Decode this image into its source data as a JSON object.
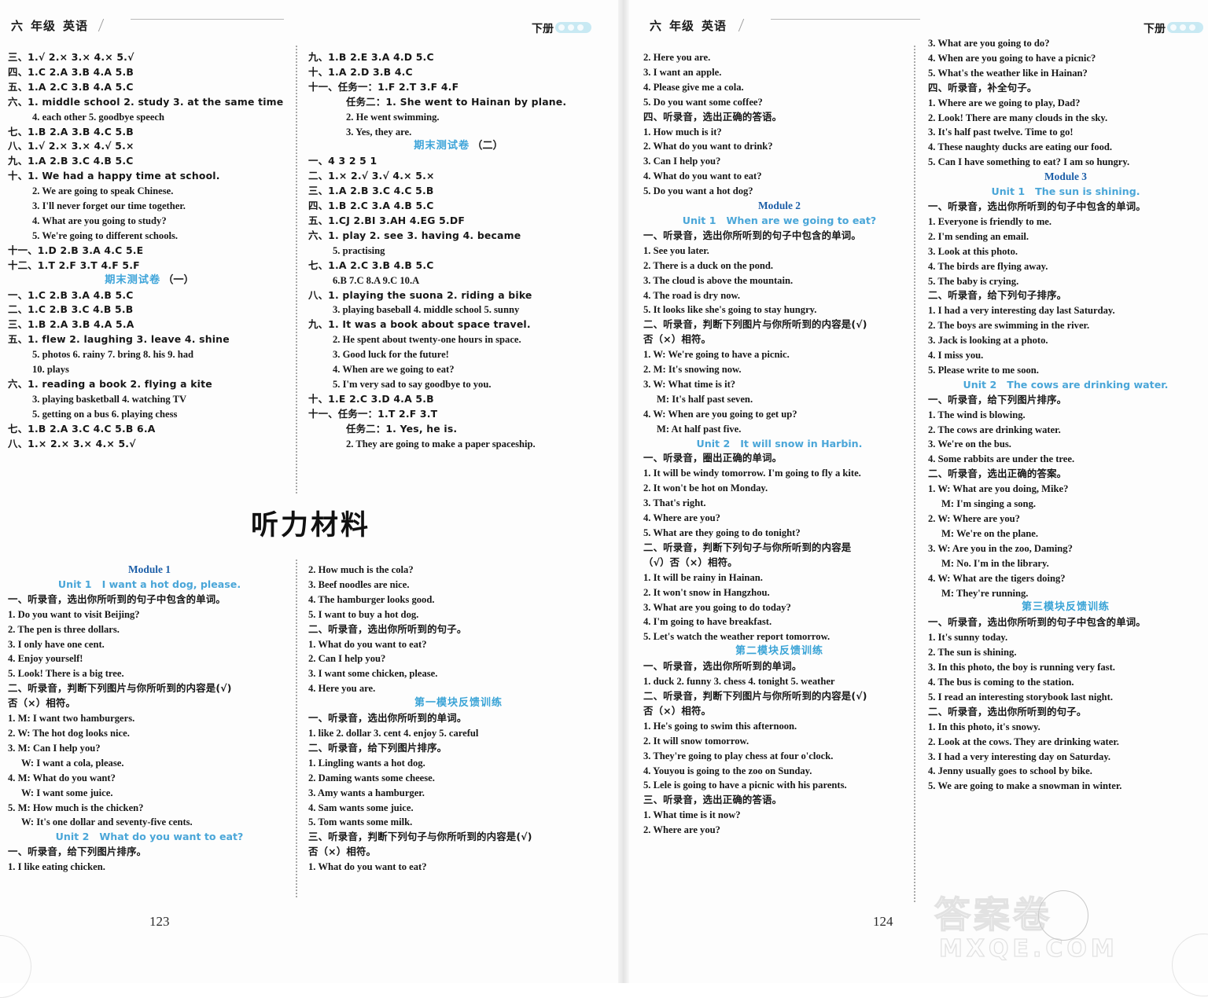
{
  "book": {
    "header_grade": "六",
    "header_grade_label": "年级",
    "header_subject": "英语",
    "header_right": "下册",
    "page_left": "123",
    "page_right": "124",
    "watermark_cn": "答案卷",
    "watermark_en": "MXQE.COM"
  },
  "section_title": "听力材料",
  "col1": {
    "lines": [
      {
        "t": "三、1.√  2.×  3.×  4.×  5.√",
        "s": "cn"
      },
      {
        "t": "四、1.C  2.A  3.B  4.A  5.B",
        "s": "cn"
      },
      {
        "t": "五、1.A  2.C  3.B  4.A  5.C",
        "s": "cn"
      },
      {
        "t": "六、1. middle school  2. study  3. at the same time",
        "s": "cn"
      },
      {
        "t": "4. each other  5. goodbye speech",
        "s": "ind2"
      },
      {
        "t": "七、1.B  2.A  3.B  4.C  5.B",
        "s": "cn"
      },
      {
        "t": "八、1.√  2.×  3.×  4.√  5.×",
        "s": "cn"
      },
      {
        "t": "九、1.A  2.B  3.C  4.B  5.C",
        "s": "cn"
      },
      {
        "t": "十、1. We had a happy time at school.",
        "s": "cn"
      },
      {
        "t": "2. We are going to speak Chinese.",
        "s": "ind2"
      },
      {
        "t": "3. I'll never forget our time together.",
        "s": "ind2"
      },
      {
        "t": "4. What are you going to study?",
        "s": "ind2"
      },
      {
        "t": "5. We're going to different schools.",
        "s": "ind2"
      },
      {
        "t": "十一、1.D  2.B  3.A  4.C  5.E",
        "s": "cn"
      },
      {
        "t": "十二、1.T  2.F  3.T  4.F  5.F",
        "s": "cn"
      },
      {
        "t": "期末测试卷（一）",
        "s": "examhd"
      },
      {
        "t": "一、1.C  2.B  3.A  4.B  5.C",
        "s": "cn"
      },
      {
        "t": "二、1.C  2.B  3.C  4.B  5.B",
        "s": "cn"
      },
      {
        "t": "三、1.B  2.A  3.B  4.A  5.A",
        "s": "cn"
      },
      {
        "t": "五、1. flew  2. laughing  3. leave  4. shine",
        "s": "cn"
      },
      {
        "t": "5. photos  6. rainy  7. bring  8. his  9. had",
        "s": "ind2"
      },
      {
        "t": "10. plays",
        "s": "ind2"
      },
      {
        "t": "六、1. reading a book  2. flying a kite",
        "s": "cn"
      },
      {
        "t": "3. playing basketball  4. watching TV",
        "s": "ind2"
      },
      {
        "t": "5. getting on a bus  6. playing chess",
        "s": "ind2"
      },
      {
        "t": "七、1.B  2.A  3.C  4.C  5.B  6.A",
        "s": "cn"
      },
      {
        "t": "八、1.×  2.×  3.×  4.×  5.√",
        "s": "cn"
      }
    ]
  },
  "col2": {
    "lines": [
      {
        "t": "九、1.B  2.E  3.A  4.D  5.C",
        "s": "cn"
      },
      {
        "t": "十、1.A  2.D  3.B  4.C",
        "s": "cn"
      },
      {
        "t": "十一、任务一：1.F  2.T  3.F  4.F",
        "s": "cn"
      },
      {
        "t": "任务二：1. She went to Hainan by plane.",
        "s": "cn ind3"
      },
      {
        "t": "2. He went swimming.",
        "s": "ind3"
      },
      {
        "t": "3. Yes, they are.",
        "s": "ind3"
      },
      {
        "t": "期末测试卷（二）",
        "s": "examhd"
      },
      {
        "t": "一、4  3  2  5  1",
        "s": "cn"
      },
      {
        "t": "二、1.×  2.√  3.√  4.×  5.×",
        "s": "cn"
      },
      {
        "t": "三、1.A  2.B  3.C  4.C  5.B",
        "s": "cn"
      },
      {
        "t": "四、1.B  2.C  3.A  4.B  5.C",
        "s": "cn"
      },
      {
        "t": "五、1.CJ  2.BI  3.AH  4.EG  5.DF",
        "s": "cn"
      },
      {
        "t": "六、1. play  2. see  3. having  4. became",
        "s": "cn"
      },
      {
        "t": "5. practising",
        "s": "ind2"
      },
      {
        "t": "七、1.A  2.C  3.B  4.B  5.C",
        "s": "cn"
      },
      {
        "t": "6.B  7.C  8.A  9.C  10.A",
        "s": "ind2"
      },
      {
        "t": "八、1. playing the suona  2. riding a bike",
        "s": "cn"
      },
      {
        "t": "3. playing baseball  4. middle school  5. sunny",
        "s": "ind2"
      },
      {
        "t": "九、1. It was a book about space travel.",
        "s": "cn"
      },
      {
        "t": "2. He spent about twenty-one hours in space.",
        "s": "ind2"
      },
      {
        "t": "3. Good luck for the future!",
        "s": "ind2"
      },
      {
        "t": "4. When are we going to eat?",
        "s": "ind2"
      },
      {
        "t": "5. I'm very sad to say goodbye to you.",
        "s": "ind2"
      },
      {
        "t": "十、1.E  2.C  3.D  4.A  5.B",
        "s": "cn"
      },
      {
        "t": "十一、任务一：1.T  2.F  3.T",
        "s": "cn"
      },
      {
        "t": "任务二：1. Yes, he is.",
        "s": "cn ind3"
      },
      {
        "t": "2. They are going to make a paper spaceship.",
        "s": "ind3"
      }
    ]
  },
  "col1b": {
    "lines": [
      {
        "t": "Module 1",
        "s": "modhd"
      },
      {
        "t": "Unit 1|I want a hot dog, please.",
        "s": "unithd"
      },
      {
        "t": "一、听录音，选出你所听到的句子中包含的单词。",
        "s": "cn"
      },
      {
        "t": "1. Do you want to visit Beijing?",
        "s": ""
      },
      {
        "t": "2. The pen is three dollars.",
        "s": ""
      },
      {
        "t": "3. I only have one cent.",
        "s": ""
      },
      {
        "t": "4. Enjoy yourself!",
        "s": ""
      },
      {
        "t": "5. Look! There is a big tree.",
        "s": ""
      },
      {
        "t": "二、听录音，判断下列图片与你所听到的内容是(√)",
        "s": "cn"
      },
      {
        "t": "否（×）相符。",
        "s": "cn"
      },
      {
        "t": "1. M: I want two hamburgers.",
        "s": ""
      },
      {
        "t": "2. W: The hot dog looks nice.",
        "s": ""
      },
      {
        "t": "3. M: Can I help you?",
        "s": ""
      },
      {
        "t": "W: I want a cola, please.",
        "s": "ind1"
      },
      {
        "t": "4. M: What do you want?",
        "s": ""
      },
      {
        "t": "W: I want some juice.",
        "s": "ind1"
      },
      {
        "t": "5. M: How much is the chicken?",
        "s": ""
      },
      {
        "t": "W: It's one dollar and seventy-five cents.",
        "s": "ind1"
      },
      {
        "t": "Unit 2|What do you want to eat?",
        "s": "unithd"
      },
      {
        "t": "一、听录音，给下列图片排序。",
        "s": "cn"
      },
      {
        "t": "1. I like eating chicken.",
        "s": ""
      }
    ]
  },
  "col2b": {
    "lines": [
      {
        "t": "2. How much is the cola?",
        "s": ""
      },
      {
        "t": "3. Beef noodles are nice.",
        "s": ""
      },
      {
        "t": "4. The hamburger looks good.",
        "s": ""
      },
      {
        "t": "5. I want to buy a hot dog.",
        "s": ""
      },
      {
        "t": "二、听录音，选出你所听到的句子。",
        "s": "cn"
      },
      {
        "t": "1. What do you want to eat?",
        "s": ""
      },
      {
        "t": "2. Can I help you?",
        "s": ""
      },
      {
        "t": "3. I want some chicken, please.",
        "s": ""
      },
      {
        "t": "4. Here you are.",
        "s": ""
      },
      {
        "t": "第一模块反馈训练",
        "s": "bluecn"
      },
      {
        "t": "一、听录音，选出你所听到的单词。",
        "s": "cn"
      },
      {
        "t": "1. like  2. dollar  3. cent  4. enjoy  5. careful",
        "s": ""
      },
      {
        "t": "二、听录音，给下列图片排序。",
        "s": "cn"
      },
      {
        "t": "1. Lingling wants a hot dog.",
        "s": ""
      },
      {
        "t": "2. Daming wants some cheese.",
        "s": ""
      },
      {
        "t": "3. Amy wants a hamburger.",
        "s": ""
      },
      {
        "t": "4. Sam wants some juice.",
        "s": ""
      },
      {
        "t": "5. Tom wants some milk.",
        "s": ""
      },
      {
        "t": "三、听录音，判断下列句子与你所听到的内容是(√)",
        "s": "cn"
      },
      {
        "t": "否（×）相符。",
        "s": "cn"
      },
      {
        "t": "1. What do you want to eat?",
        "s": ""
      }
    ]
  },
  "col3": {
    "lines": [
      {
        "t": "2. Here you are.",
        "s": ""
      },
      {
        "t": "3. I want an apple.",
        "s": ""
      },
      {
        "t": "4. Please give me a cola.",
        "s": ""
      },
      {
        "t": "5. Do you want some coffee?",
        "s": ""
      },
      {
        "t": "四、听录音，选出正确的答语。",
        "s": "cn"
      },
      {
        "t": "1. How much is it?",
        "s": ""
      },
      {
        "t": "2. What do you want to drink?",
        "s": ""
      },
      {
        "t": "3. Can I help you?",
        "s": ""
      },
      {
        "t": "4. What do you want to eat?",
        "s": ""
      },
      {
        "t": "5. Do you want a hot dog?",
        "s": ""
      },
      {
        "t": "Module 2",
        "s": "modhd"
      },
      {
        "t": "Unit 1|When are we going to eat?",
        "s": "unithd"
      },
      {
        "t": "一、听录音，选出你所听到的句子中包含的单词。",
        "s": "cn"
      },
      {
        "t": "1. See you later.",
        "s": ""
      },
      {
        "t": "2. There is a duck on the pond.",
        "s": ""
      },
      {
        "t": "3. The cloud is above the mountain.",
        "s": ""
      },
      {
        "t": "4. The road is dry now.",
        "s": ""
      },
      {
        "t": "5. It looks like she's going to stay hungry.",
        "s": ""
      },
      {
        "t": "二、听录音，判断下列图片与你所听到的内容是(√)",
        "s": "cn"
      },
      {
        "t": "否（×）相符。",
        "s": "cn"
      },
      {
        "t": "1. W: We're going to have a picnic.",
        "s": ""
      },
      {
        "t": "2. M: It's snowing now.",
        "s": ""
      },
      {
        "t": "3. W: What time is it?",
        "s": ""
      },
      {
        "t": "M: It's half past seven.",
        "s": "ind1"
      },
      {
        "t": "4. W: When are you going to get up?",
        "s": ""
      },
      {
        "t": "M: At half past five.",
        "s": "ind1"
      },
      {
        "t": "Unit 2|It will snow in Harbin.",
        "s": "unithd"
      },
      {
        "t": "一、听录音，圈出正确的单词。",
        "s": "cn"
      },
      {
        "t": "1. It will be windy tomorrow. I'm going to fly a kite.",
        "s": ""
      },
      {
        "t": "2. It won't be hot on Monday.",
        "s": ""
      },
      {
        "t": "3. That's right.",
        "s": ""
      },
      {
        "t": "4. Where are you?",
        "s": ""
      },
      {
        "t": "5. What are they going to do tonight?",
        "s": ""
      },
      {
        "t": "二、听录音，判断下列句子与你所听到的内容是",
        "s": "cn"
      },
      {
        "t": "（√）否（×）相符。",
        "s": "cn"
      },
      {
        "t": "1. It will be rainy in Hainan.",
        "s": ""
      },
      {
        "t": "2. It won't snow in Hangzhou.",
        "s": ""
      },
      {
        "t": "3. What are you going to do today?",
        "s": ""
      },
      {
        "t": "4. I'm going to have breakfast.",
        "s": ""
      },
      {
        "t": "5. Let's watch the weather report tomorrow.",
        "s": ""
      },
      {
        "t": "第二模块反馈训练",
        "s": "bluecn"
      },
      {
        "t": "一、听录音，选出你所听到的单词。",
        "s": "cn"
      },
      {
        "t": "1. duck  2. funny  3. chess  4. tonight  5. weather",
        "s": ""
      },
      {
        "t": "二、听录音，判断下列图片与你所听到的内容是(√)",
        "s": "cn"
      },
      {
        "t": "否（×）相符。",
        "s": "cn"
      },
      {
        "t": "1. He's going to swim this afternoon.",
        "s": ""
      },
      {
        "t": "2. It will snow tomorrow.",
        "s": ""
      },
      {
        "t": "3. They're going to play chess at four o'clock.",
        "s": ""
      },
      {
        "t": "4. Youyou is going to the zoo on Sunday.",
        "s": ""
      },
      {
        "t": "5. Lele is going to have a picnic with his parents.",
        "s": ""
      },
      {
        "t": "三、听录音，选出正确的答语。",
        "s": "cn"
      },
      {
        "t": "1. What time is it now?",
        "s": ""
      },
      {
        "t": "2. Where are you?",
        "s": ""
      }
    ]
  },
  "col4": {
    "lines": [
      {
        "t": "3. What are you going to do?",
        "s": ""
      },
      {
        "t": "4. When are you going to have a picnic?",
        "s": ""
      },
      {
        "t": "5. What's the weather like in Hainan?",
        "s": ""
      },
      {
        "t": "四、听录音，补全句子。",
        "s": "cn"
      },
      {
        "t": "1. Where are we going to play, Dad?",
        "s": ""
      },
      {
        "t": "2. Look! There are many clouds in the sky.",
        "s": ""
      },
      {
        "t": "3. It's half past twelve. Time to go!",
        "s": ""
      },
      {
        "t": "4. These naughty ducks are eating our food.",
        "s": ""
      },
      {
        "t": "5. Can I have something to eat? I am so hungry.",
        "s": ""
      },
      {
        "t": "Module 3",
        "s": "modhd"
      },
      {
        "t": "Unit 1|The sun is shining.",
        "s": "unithd"
      },
      {
        "t": "一、听录音，选出你所听到的句子中包含的单词。",
        "s": "cn"
      },
      {
        "t": "1. Everyone is friendly to me.",
        "s": ""
      },
      {
        "t": "2. I'm sending an email.",
        "s": ""
      },
      {
        "t": "3. Look at this photo.",
        "s": ""
      },
      {
        "t": "4. The birds are flying away.",
        "s": ""
      },
      {
        "t": "5. The baby is crying.",
        "s": ""
      },
      {
        "t": "二、听录音，给下列句子排序。",
        "s": "cn"
      },
      {
        "t": "1. I had a very interesting day last Saturday.",
        "s": ""
      },
      {
        "t": "2. The boys are swimming in the river.",
        "s": ""
      },
      {
        "t": "3. Jack is looking at a photo.",
        "s": ""
      },
      {
        "t": "4. I miss you.",
        "s": ""
      },
      {
        "t": "5. Please write to me soon.",
        "s": ""
      },
      {
        "t": "Unit 2|The cows are drinking water.",
        "s": "unithd"
      },
      {
        "t": "一、听录音，给下列图片排序。",
        "s": "cn"
      },
      {
        "t": "1. The wind is blowing.",
        "s": ""
      },
      {
        "t": "2. The cows are drinking water.",
        "s": ""
      },
      {
        "t": "3. We're on the bus.",
        "s": ""
      },
      {
        "t": "4. Some rabbits are under the tree.",
        "s": ""
      },
      {
        "t": "二、听录音，选出正确的答案。",
        "s": "cn"
      },
      {
        "t": "1. W: What are you doing, Mike?",
        "s": ""
      },
      {
        "t": "M: I'm singing a song.",
        "s": "ind1"
      },
      {
        "t": "2. W: Where are you?",
        "s": ""
      },
      {
        "t": "M: We're on the plane.",
        "s": "ind1"
      },
      {
        "t": "3. W: Are you in the zoo, Daming?",
        "s": ""
      },
      {
        "t": "M: No. I'm in the library.",
        "s": "ind1"
      },
      {
        "t": "4. W: What are the tigers doing?",
        "s": ""
      },
      {
        "t": "M: They're running.",
        "s": "ind1"
      },
      {
        "t": "第三模块反馈训练",
        "s": "bluecn"
      },
      {
        "t": "一、听录音，选出你所听到的句子中包含的单词。",
        "s": "cn"
      },
      {
        "t": "1. It's sunny today.",
        "s": ""
      },
      {
        "t": "2. The sun is shining.",
        "s": ""
      },
      {
        "t": "3. In this photo, the boy is running very fast.",
        "s": ""
      },
      {
        "t": "4. The bus is coming to the station.",
        "s": ""
      },
      {
        "t": "5. I read an interesting storybook last night.",
        "s": ""
      },
      {
        "t": "二、听录音，选出你所听到的句子。",
        "s": "cn"
      },
      {
        "t": "1. In this photo, it's snowy.",
        "s": ""
      },
      {
        "t": "2. Look at the cows. They are drinking water.",
        "s": ""
      },
      {
        "t": "3. I had a very interesting day on Saturday.",
        "s": ""
      },
      {
        "t": "4. Jenny usually goes to school by bike.",
        "s": ""
      },
      {
        "t": "5. We are going to make a snowman in winter.",
        "s": ""
      }
    ]
  }
}
